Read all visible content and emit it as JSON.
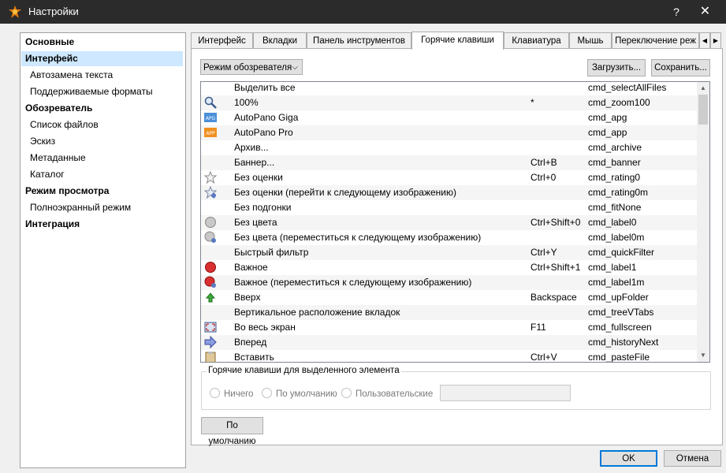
{
  "window": {
    "title": "Настройки",
    "help_glyph": "?",
    "close_glyph": "✕"
  },
  "sidebar": {
    "items": [
      {
        "label": "Основные",
        "kind": "cat"
      },
      {
        "label": "Интерфейс",
        "kind": "cat",
        "selected": true
      },
      {
        "label": "Автозамена текста",
        "kind": "sub"
      },
      {
        "label": "Поддерживаемые форматы",
        "kind": "sub"
      },
      {
        "label": "Обозреватель",
        "kind": "cat"
      },
      {
        "label": "Список файлов",
        "kind": "sub"
      },
      {
        "label": "Эскиз",
        "kind": "sub"
      },
      {
        "label": "Метаданные",
        "kind": "sub"
      },
      {
        "label": "Каталог",
        "kind": "sub"
      },
      {
        "label": "Режим просмотра",
        "kind": "cat"
      },
      {
        "label": "Полноэкранный режим",
        "kind": "sub"
      },
      {
        "label": "Интеграция",
        "kind": "cat"
      }
    ]
  },
  "tabs": [
    {
      "label": "Интерфейс"
    },
    {
      "label": "Вкладки"
    },
    {
      "label": "Панель инструментов"
    },
    {
      "label": "Горячие клавиши",
      "active": true
    },
    {
      "label": "Клавиатура"
    },
    {
      "label": "Мышь"
    },
    {
      "label": "Переключение реж"
    }
  ],
  "toolbar": {
    "mode_select": "Режим обозревателя",
    "load_label": "Загрузить...",
    "save_label": "Сохранить..."
  },
  "shortcuts": [
    {
      "name": "Выделить все",
      "key": "",
      "cmd": "cmd_selectAllFiles",
      "icon": ""
    },
    {
      "name": "100%",
      "key": "*",
      "cmd": "cmd_zoom100",
      "icon": "zoom-icon"
    },
    {
      "name": "AutoPano Giga",
      "key": "",
      "cmd": "cmd_apg",
      "icon": "autopano-giga-icon"
    },
    {
      "name": "AutoPano Pro",
      "key": "",
      "cmd": "cmd_app",
      "icon": "autopano-pro-icon"
    },
    {
      "name": "Архив...",
      "key": "",
      "cmd": "cmd_archive",
      "icon": ""
    },
    {
      "name": "Баннер...",
      "key": "Ctrl+B",
      "cmd": "cmd_banner",
      "icon": ""
    },
    {
      "name": "Без оценки",
      "key": "Ctrl+0",
      "cmd": "cmd_rating0",
      "icon": "star-outline-icon"
    },
    {
      "name": "Без оценки (перейти к следующему изображению)",
      "key": "",
      "cmd": "cmd_rating0m",
      "icon": "star-next-icon"
    },
    {
      "name": "Без подгонки",
      "key": "",
      "cmd": "cmd_fitNone",
      "icon": ""
    },
    {
      "name": "Без цвета",
      "key": "Ctrl+Shift+0",
      "cmd": "cmd_label0",
      "icon": "gray-circle-icon"
    },
    {
      "name": "Без цвета (переместиться к следующему изображению)",
      "key": "",
      "cmd": "cmd_label0m",
      "icon": "gray-circle-next-icon"
    },
    {
      "name": "Быстрый фильтр",
      "key": "Ctrl+Y",
      "cmd": "cmd_quickFilter",
      "icon": ""
    },
    {
      "name": "Важное",
      "key": "Ctrl+Shift+1",
      "cmd": "cmd_label1",
      "icon": "red-circle-icon"
    },
    {
      "name": "Важное (переместиться к следующему изображению)",
      "key": "",
      "cmd": "cmd_label1m",
      "icon": "red-circle-next-icon"
    },
    {
      "name": "Вверх",
      "key": "Backspace",
      "cmd": "cmd_upFolder",
      "icon": "up-folder-icon"
    },
    {
      "name": "Вертикальное расположение вкладок",
      "key": "",
      "cmd": "cmd_treeVTabs",
      "icon": ""
    },
    {
      "name": "Во весь экран",
      "key": "F11",
      "cmd": "cmd_fullscreen",
      "icon": "fullscreen-icon"
    },
    {
      "name": "Вперед",
      "key": "",
      "cmd": "cmd_historyNext",
      "icon": "forward-arrow-icon"
    },
    {
      "name": "Вставить",
      "key": "Ctrl+V",
      "cmd": "cmd_pasteFile",
      "icon": "paste-icon"
    }
  ],
  "hotkey_group": {
    "legend": "Горячие клавиши для выделенного элемента",
    "radio_none": "Ничего",
    "radio_default": "По умолчанию",
    "radio_custom": "Пользовательские"
  },
  "defaults_button": "По умолчанию",
  "footer": {
    "ok_label": "OK",
    "cancel_label": "Отмена"
  }
}
